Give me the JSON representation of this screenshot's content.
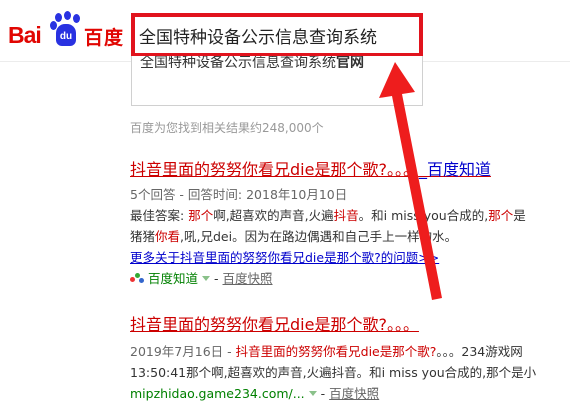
{
  "header": {
    "logo_latin": "Bai",
    "logo_paw_text": "du",
    "logo_chinese": "百度",
    "search_value": "全国特种设备公示信息查询系统"
  },
  "suggestion": {
    "prefix": "全国特种设备公示信息查询系统",
    "bold": "官网"
  },
  "result_count": "百度为您找到相关结果约248,000个",
  "results": [
    {
      "title": "抖音里面的努努你看兄die是那个歌?。。。",
      "title_suffix": "_百度知道",
      "meta": "5个回答 - 回答时间: 2018年10月10日",
      "snippet1_pre": "最佳答案: ",
      "snippet1_em1": "那个",
      "snippet1_mid1": "啊,超喜欢的声音,火遍",
      "snippet1_em2": "抖音",
      "snippet1_mid2": "。和i miss you合成的,",
      "snippet1_em3": "那个",
      "snippet1_end": "是",
      "snippet2_pre": "猪猪",
      "snippet2_em": "你看",
      "snippet2_end": ",吼,兄dei。因为在路边偶遇和自己手上一样的水。",
      "more_link": "更多关于抖音里面的努努你看兄die是那个歌?的问题>>",
      "source": "百度知道",
      "snapshot": "百度快照"
    },
    {
      "title": "抖音里面的努努你看兄die是那个歌?。。。",
      "meta_date": "2019年7月16日 - ",
      "meta_em": "抖音里面的努努你看兄die是那个歌?",
      "meta_end": "。。。234游戏网",
      "snippet": "13:50:41那个啊,超喜欢的声音,火遍抖音。和i miss you合成的,那个是小",
      "source": "mipzhidao.game234.com/...",
      "snapshot": "百度快照"
    }
  ],
  "colors": {
    "accent_red": "#e1131d",
    "arrow_red": "#ee1d1d",
    "link_blue": "#00c",
    "result_red": "#c00",
    "source_green": "#008000"
  }
}
